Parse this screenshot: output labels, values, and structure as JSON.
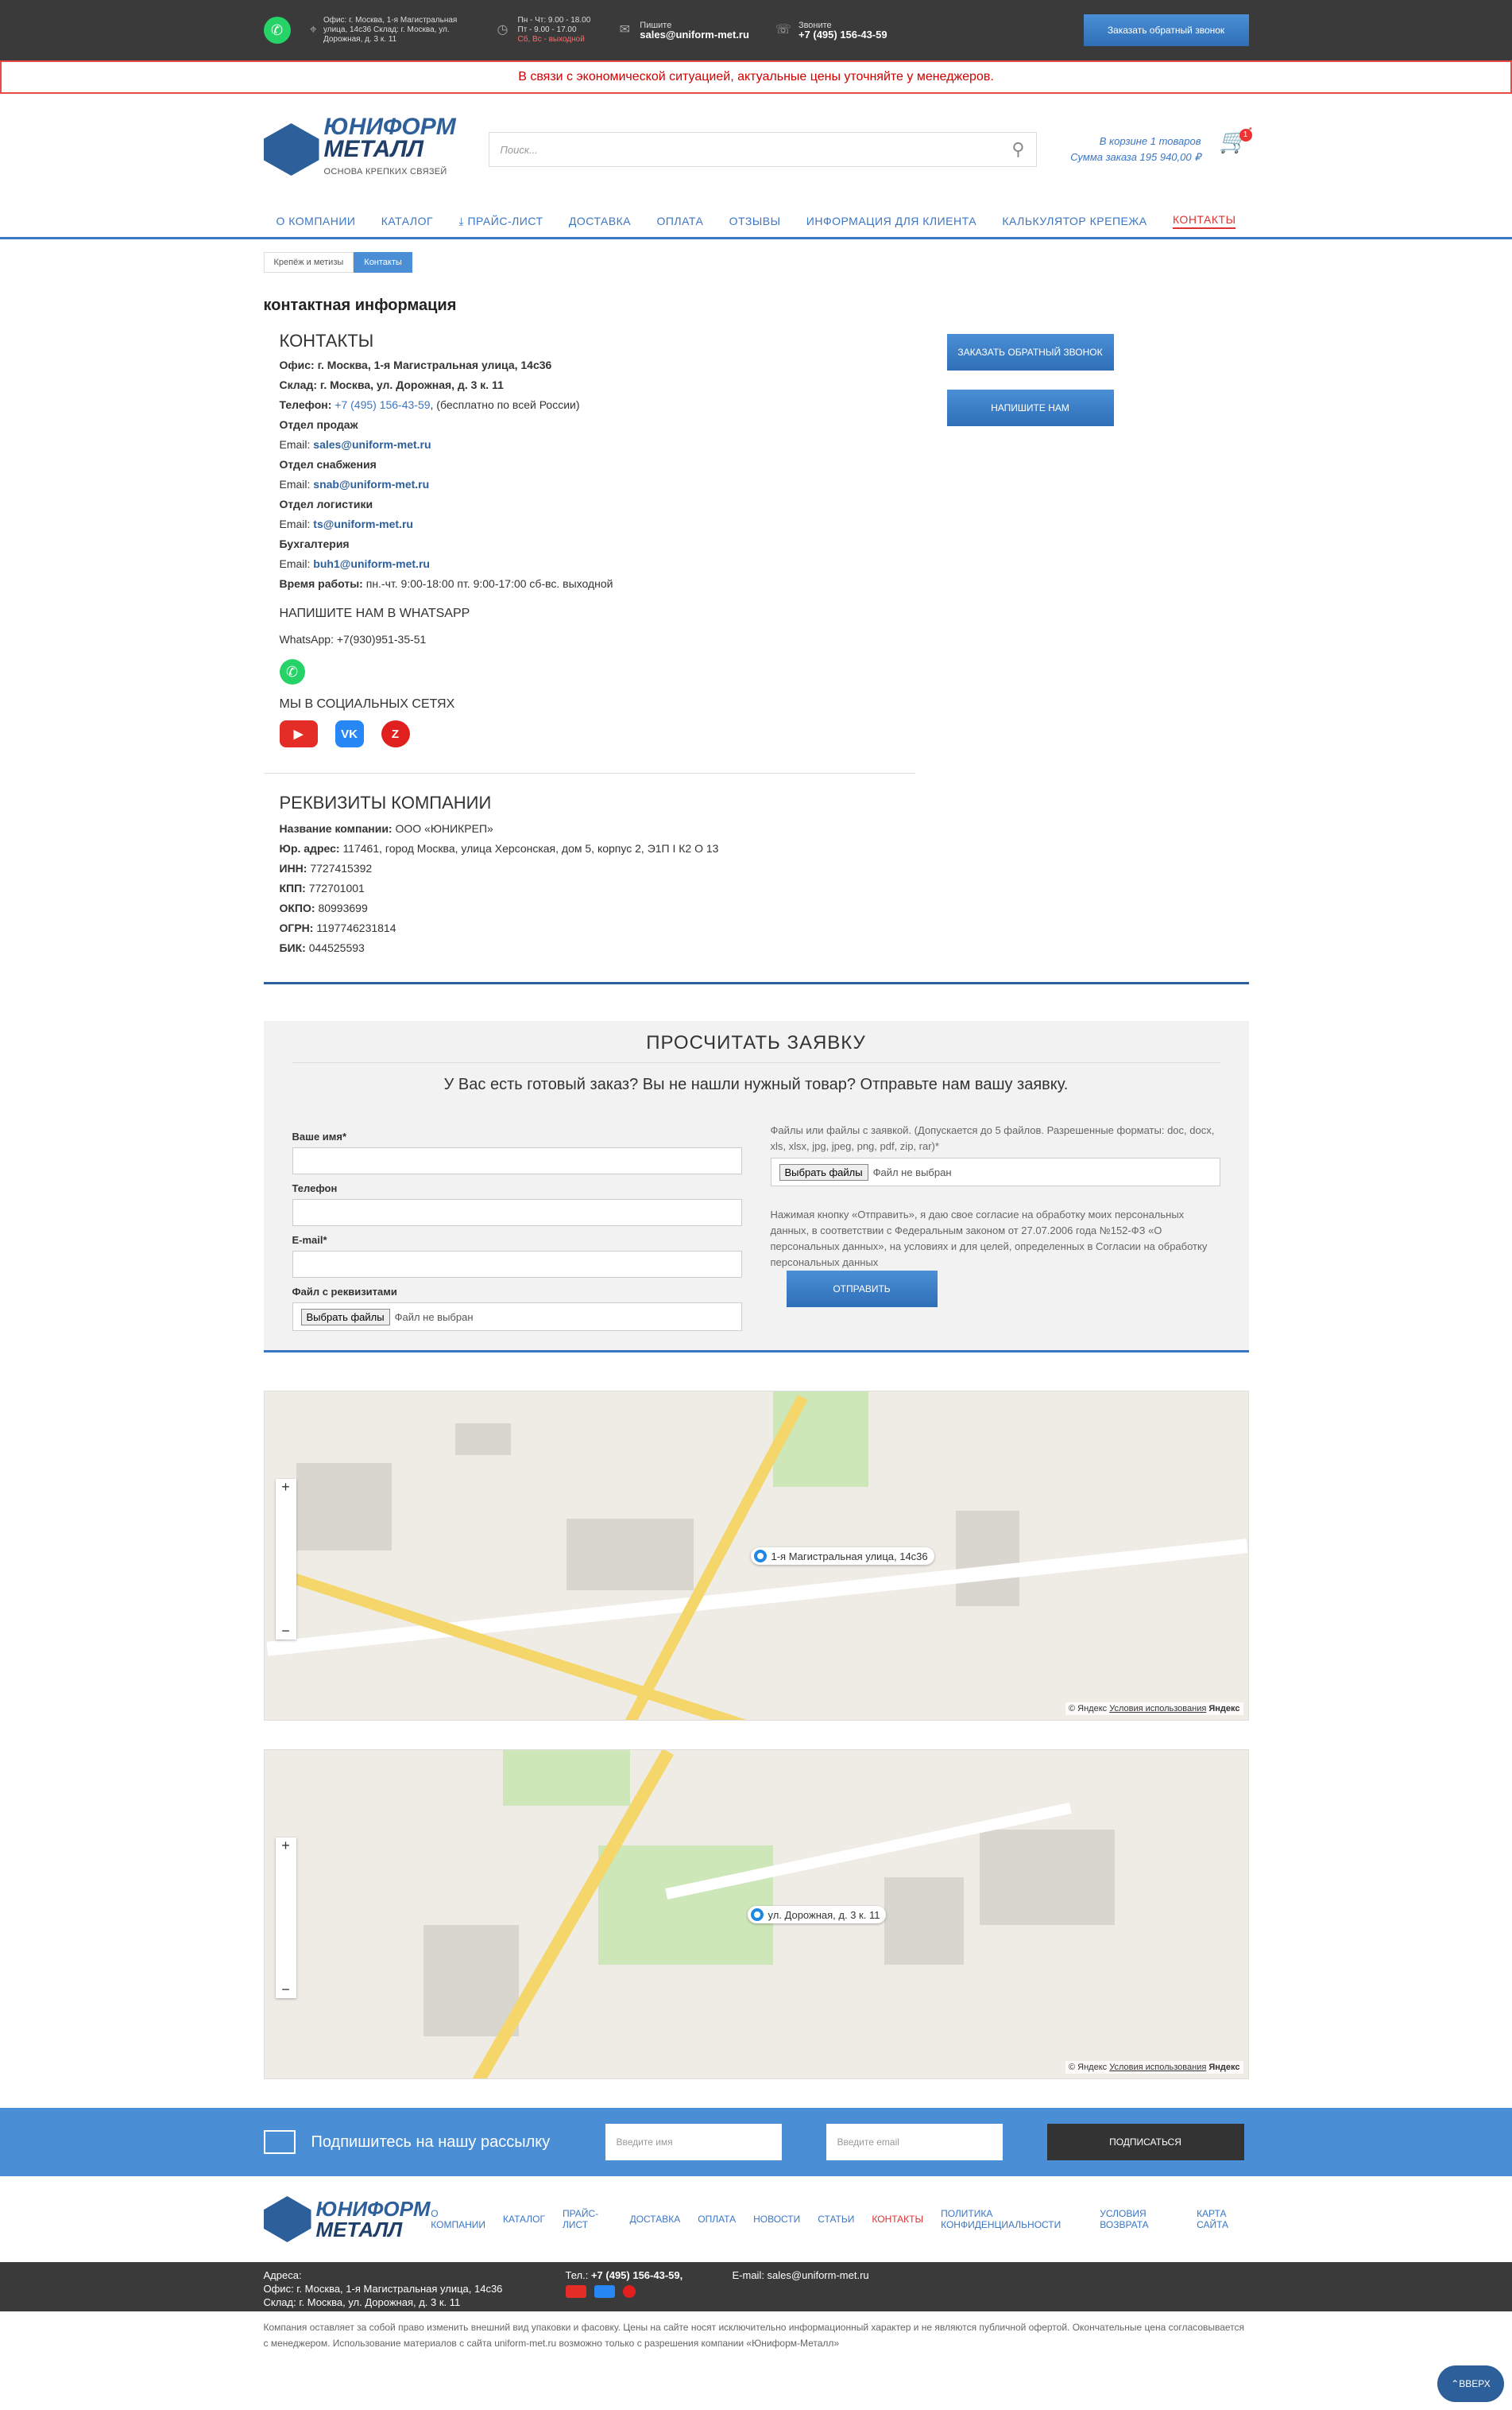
{
  "topbar": {
    "address": "Офис: г. Москва, 1-я Магистральная улица, 14с36 Склад: г. Москва, ул. Дорожная, д. 3 к. 11",
    "hours_week": "Пн - Чт: 9.00 - 18.00",
    "hours_fri": "Пт - 9.00 - 17.00",
    "hours_weekend": "Сб, Вс - выходной",
    "write_label": "Пишите",
    "email": "sales@uniform-met.ru",
    "call_label": "Звоните",
    "phone": "+7 (495) 156-43-59",
    "callback_btn": "Заказать обратный звонок"
  },
  "notice": "В связи с экономической ситуацией, актуальные цены уточняйте у менеджеров.",
  "logo": {
    "line1": "ЮНИФОРМ",
    "line2": "МЕТАЛЛ",
    "tagline": "ОСНОВА КРЕПКИХ СВЯЗЕЙ"
  },
  "search": {
    "placeholder": "Поиск..."
  },
  "cart": {
    "line1": "В корзине 1 товаров",
    "line2": "Сумма заказа 195 940,00 ₽",
    "count": "1"
  },
  "nav": [
    "О КОМПАНИИ",
    "КАТАЛОГ",
    "ПРАЙС-ЛИСТ",
    "ДОСТАВКА",
    "ОПЛАТА",
    "ОТЗЫВЫ",
    "ИНФОРМАЦИЯ ДЛЯ КЛИЕНТА",
    "КАЛЬКУЛЯТОР КРЕПЕЖА",
    "КОНТАКТЫ"
  ],
  "breadcrumbs": [
    "Крепёж и метизы",
    "Контакты"
  ],
  "page_title": "контактная информация",
  "contacts": {
    "heading": "КОНТАКТЫ",
    "office": "Офис: г. Москва, 1-я Магистральная улица, 14с36",
    "warehouse": "Склад: г. Москва, ул. Дорожная, д. 3 к. 11",
    "phone_label": "Телефон:",
    "phone": "+7 (495) 156-43-59",
    "phone_note": ", (бесплатно по всей России)",
    "sales_label": "Отдел продаж",
    "email_label": "Email:",
    "sales_email": "sales@uniform-met.ru",
    "supply_label": "Отдел снабжения",
    "supply_email": "snab@uniform-met.ru",
    "logistics_label": "Отдел логистики",
    "logistics_email": "ts@uniform-met.ru",
    "accounting_label": "Бухгалтерия",
    "accounting_email": "buh1@uniform-met.ru",
    "hours_label": "Время работы:",
    "hours": "пн.-чт. 9:00-18:00 пт. 9:00-17:00 сб-вс. выходной",
    "whatsapp_heading": "НАПИШИТЕ НАМ В WHATSAPP",
    "whatsapp": "WhatsApp: +7(930)951-35-51",
    "social_heading": "МЫ В СОЦИАЛЬНЫХ СЕТЯХ",
    "btn_callback": "ЗАКАЗАТЬ ОБРАТНЫЙ ЗВОНОК",
    "btn_write": "НАПИШИТЕ НАМ"
  },
  "requisites": {
    "heading": "РЕКВИЗИТЫ КОМПАНИИ",
    "name_label": "Название компании:",
    "name": "ООО «ЮНИКРЕП»",
    "address_label": "Юр. адрес:",
    "address": "117461, город Москва, улица Херсонская, дом 5, корпус 2, Э1П I К2 О 13",
    "inn_label": "ИНН:",
    "inn": "7727415392",
    "kpp_label": "КПП:",
    "kpp": "772701001",
    "okpo_label": "ОКПО:",
    "okpo": "80993699",
    "ogrn_label": "ОГРН:",
    "ogrn": "1197746231814",
    "bik_label": "БИК:",
    "bik": "044525593"
  },
  "order": {
    "heading": "ПРОСЧИТАТЬ ЗАЯВКУ",
    "sub": "У Вас есть готовый заказ? Вы не нашли нужный товар? Отправьте нам вашу заявку.",
    "name_label": "Ваше имя*",
    "phone_label": "Телефон",
    "email_label": "E-mail*",
    "file_label": "Файл с реквизитами",
    "file_btn": "Выбрать файлы",
    "file_none": "Файл не выбран",
    "files_note": "Файлы или файлы с заявкой. (Допускается до 5 файлов. Разрешенные форматы: doc, docx, xls, xlsx, jpg, jpeg, png, pdf, zip, rar)*",
    "file_btn2": "Выбрать файлы",
    "consent": "Нажимая кнопку «Отправить», я даю свое согласие на обработку моих персональных данных, в соответствии с Федеральным законом от 27.07.2006 года №152-ФЗ «О персональных данных», на условиях и для целей, определенных в Согласии на обработку персональных данных",
    "submit": "ОТПРАВИТЬ"
  },
  "maps": {
    "pin1": "1-я Магистральная улица, 14с36",
    "pin2": "ул. Дорожная, д. 3 к. 11",
    "copyright": "© Яндекс",
    "terms": "Условия использования",
    "brand": "Яндекс"
  },
  "subscribe": {
    "title": "Подпишитесь на нашу рассылку",
    "name_ph": "Введите имя",
    "email_ph": "Введите email",
    "btn": "ПОДПИСАТЬСЯ"
  },
  "footer_nav": [
    "О КОМПАНИИ",
    "КАТАЛОГ",
    "ПРАЙС-ЛИСТ",
    "ДОСТАВКА",
    "ОПЛАТА",
    "НОВОСТИ",
    "СТАТЬИ",
    "КОНТАКТЫ",
    "ПОЛИТИКА КОНФИДЕНЦИАЛЬНОСТИ",
    "УСЛОВИЯ ВОЗВРАТА",
    "КАРТА САЙТА"
  ],
  "footer": {
    "addr_label": "Адреса:",
    "addr1": "Офис: г. Москва, 1-я Магистральная улица, 14с36",
    "addr2": "Склад: г. Москва, ул. Дорожная, д. 3 к. 11",
    "tel_label": "Тел.:",
    "tel": "+7 (495) 156-43-59,",
    "email": "E-mail: sales@uniform-met.ru",
    "copy": "Компания оставляет за собой право изменить внешний вид упаковки и фасовку. Цены на сайте носят исключительно информационный характер и не являются публичной офертой. Окончательные цена согласовывается с менеджером. Использование материалов с сайта uniform-met.ru возможно только с разрешения компании «Юниформ-Металл»",
    "up": "ВВЕРХ"
  },
  "colors": {
    "accent": "#3b76c4",
    "brand": "#2d5f9a",
    "alert": "#d40000",
    "dark": "#3a3a3a"
  }
}
